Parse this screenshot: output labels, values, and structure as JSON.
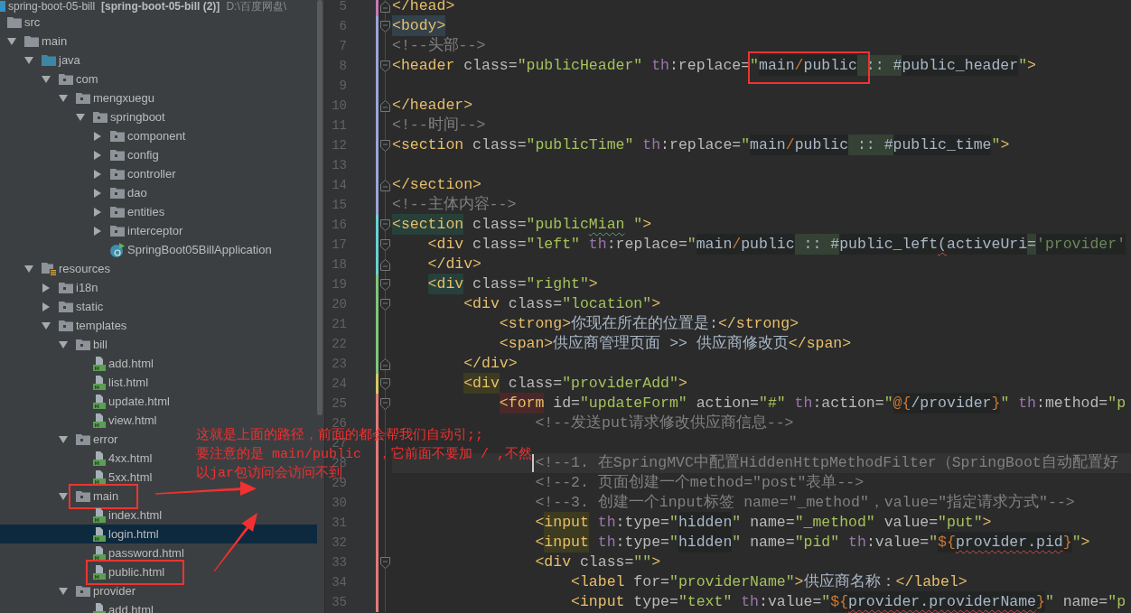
{
  "project_tree": {
    "items": [
      {
        "label": "spring-boot-05-bill",
        "module": "[spring-boot-05-bill (2)]",
        "path": "D:\\百度网盘\\",
        "kind": "module",
        "selected": false,
        "framed": false,
        "children": [
          {
            "label": "src",
            "kind": "folder",
            "selected": false,
            "framed": false,
            "children": [
              {
                "label": "main",
                "kind": "folder",
                "expanded": true,
                "selected": false,
                "framed": false,
                "children": [
                  {
                    "label": "java",
                    "kind": "source-root",
                    "expanded": true,
                    "selected": false,
                    "framed": false,
                    "children": [
                      {
                        "label": "com",
                        "kind": "package",
                        "expanded": true,
                        "selected": false,
                        "framed": false,
                        "children": [
                          {
                            "label": "mengxuegu",
                            "kind": "package",
                            "expanded": true,
                            "selected": false,
                            "framed": false,
                            "children": [
                              {
                                "label": "springboot",
                                "kind": "package",
                                "expanded": true,
                                "selected": false,
                                "framed": false,
                                "children": [
                                  {
                                    "label": "component",
                                    "kind": "package",
                                    "expanded": false,
                                    "selected": false,
                                    "framed": false
                                  },
                                  {
                                    "label": "config",
                                    "kind": "package",
                                    "expanded": false,
                                    "selected": false,
                                    "framed": false
                                  },
                                  {
                                    "label": "controller",
                                    "kind": "package",
                                    "expanded": false,
                                    "selected": false,
                                    "framed": false
                                  },
                                  {
                                    "label": "dao",
                                    "kind": "package",
                                    "expanded": false,
                                    "selected": false,
                                    "framed": false
                                  },
                                  {
                                    "label": "entities",
                                    "kind": "package",
                                    "expanded": false,
                                    "selected": false,
                                    "framed": false
                                  },
                                  {
                                    "label": "interceptor",
                                    "kind": "package",
                                    "expanded": false,
                                    "selected": false,
                                    "framed": false
                                  },
                                  {
                                    "label": "SpringBoot05BillApplication",
                                    "kind": "app-class",
                                    "selected": false,
                                    "framed": false
                                  }
                                ]
                              }
                            ]
                          }
                        ]
                      }
                    ]
                  },
                  {
                    "label": "resources",
                    "kind": "resource-root",
                    "expanded": true,
                    "selected": false,
                    "framed": false,
                    "children": [
                      {
                        "label": "i18n",
                        "kind": "package",
                        "expanded": false,
                        "selected": false,
                        "framed": false
                      },
                      {
                        "label": "static",
                        "kind": "package",
                        "expanded": false,
                        "selected": false,
                        "framed": false
                      },
                      {
                        "label": "templates",
                        "kind": "package",
                        "expanded": true,
                        "selected": false,
                        "framed": false,
                        "children": [
                          {
                            "label": "bill",
                            "kind": "package",
                            "expanded": true,
                            "selected": false,
                            "framed": false,
                            "children": [
                              {
                                "label": "add.html",
                                "kind": "html",
                                "selected": false,
                                "framed": false
                              },
                              {
                                "label": "list.html",
                                "kind": "html",
                                "selected": false,
                                "framed": false
                              },
                              {
                                "label": "update.html",
                                "kind": "html",
                                "selected": false,
                                "framed": false
                              },
                              {
                                "label": "view.html",
                                "kind": "html",
                                "selected": false,
                                "framed": false
                              }
                            ]
                          },
                          {
                            "label": "error",
                            "kind": "package",
                            "expanded": true,
                            "selected": false,
                            "framed": false,
                            "children": [
                              {
                                "label": "4xx.html",
                                "kind": "html",
                                "selected": false,
                                "framed": false
                              },
                              {
                                "label": "5xx.html",
                                "kind": "html",
                                "selected": false,
                                "framed": false
                              }
                            ]
                          },
                          {
                            "label": "main",
                            "kind": "package",
                            "expanded": true,
                            "selected": false,
                            "framed": true,
                            "children": [
                              {
                                "label": "index.html",
                                "kind": "html",
                                "selected": false,
                                "framed": false
                              },
                              {
                                "label": "login.html",
                                "kind": "html",
                                "selected": true,
                                "framed": false
                              },
                              {
                                "label": "password.html",
                                "kind": "html",
                                "selected": false,
                                "framed": false
                              },
                              {
                                "label": "public.html",
                                "kind": "html",
                                "selected": false,
                                "framed": true
                              }
                            ]
                          },
                          {
                            "label": "provider",
                            "kind": "package",
                            "expanded": true,
                            "selected": false,
                            "framed": false,
                            "children": [
                              {
                                "label": "add.html",
                                "kind": "html",
                                "selected": false,
                                "framed": false
                              }
                            ]
                          }
                        ]
                      }
                    ]
                  }
                ]
              }
            ]
          }
        ]
      }
    ]
  },
  "editor": {
    "lines": [
      {
        "number": "5",
        "kind": "close",
        "color": "#c879b6",
        "current": false,
        "tokens": [
          {
            "text": "</head>",
            "kind": "tag"
          }
        ]
      },
      {
        "number": "6",
        "kind": "open",
        "color": "#9aa5dc",
        "current": false,
        "tokens": [
          {
            "text": "<body>",
            "kind": "tagpair"
          }
        ]
      },
      {
        "number": "7",
        "kind": "plain",
        "color": "#9aa5dc",
        "current": false,
        "tokens": [
          {
            "text": "<!--头部-->",
            "kind": "comment"
          }
        ]
      },
      {
        "number": "8",
        "kind": "open",
        "color": "#9aa5dc",
        "current": false,
        "tokens": [
          {
            "text": "<header",
            "kind": "tag"
          },
          {
            "text": " class=",
            "kind": "attr"
          },
          {
            "text": "\"publicHeader\"",
            "kind": "value"
          },
          {
            "text": " th",
            "kind": "ns"
          },
          {
            "text": ":replace=",
            "kind": "attr"
          },
          {
            "text": "\"",
            "kind": "value",
            "framed": true
          },
          {
            "text": "main",
            "kind": "inject",
            "framed": true
          },
          {
            "text": "/",
            "kind": "injectop",
            "framed": true
          },
          {
            "text": "public",
            "kind": "inject",
            "framed": true
          },
          {
            "text": " :: #",
            "kind": "usage"
          },
          {
            "text": "public_header",
            "kind": "inject"
          },
          {
            "text": "\"",
            "kind": "value"
          },
          {
            "text": ">",
            "kind": "tag"
          }
        ]
      },
      {
        "number": "9",
        "kind": "plain",
        "color": "#9aa5dc",
        "current": false
      },
      {
        "number": "10",
        "kind": "close",
        "color": "#9aa5dc",
        "current": false,
        "tokens": [
          {
            "text": "</header>",
            "kind": "tag"
          }
        ]
      },
      {
        "number": "11",
        "kind": "plain",
        "color": "#9aa5dc",
        "current": false,
        "tokens": [
          {
            "text": "<!--时间-->",
            "kind": "comment"
          }
        ]
      },
      {
        "number": "12",
        "kind": "open",
        "color": "#9aa5dc",
        "current": false,
        "tokens": [
          {
            "text": "<section",
            "kind": "tag"
          },
          {
            "text": " class=",
            "kind": "attr"
          },
          {
            "text": "\"publicTime\"",
            "kind": "value"
          },
          {
            "text": " th",
            "kind": "ns"
          },
          {
            "text": ":replace=",
            "kind": "attr"
          },
          {
            "text": "\"",
            "kind": "value"
          },
          {
            "text": "main",
            "kind": "inject"
          },
          {
            "text": "/",
            "kind": "injectop"
          },
          {
            "text": "public",
            "kind": "inject"
          },
          {
            "text": " :: #",
            "kind": "usage"
          },
          {
            "text": "public_time",
            "kind": "inject"
          },
          {
            "text": "\"",
            "kind": "value"
          },
          {
            "text": ">",
            "kind": "tag"
          }
        ]
      },
      {
        "number": "13",
        "kind": "plain",
        "color": "#9aa5dc",
        "current": false
      },
      {
        "number": "14",
        "kind": "close",
        "color": "#9aa5dc",
        "current": false,
        "tokens": [
          {
            "text": "</section>",
            "kind": "tag"
          }
        ]
      },
      {
        "number": "15",
        "kind": "plain",
        "color": "#9aa5dc",
        "current": false,
        "tokens": [
          {
            "text": "<!--主体内容-->",
            "kind": "comment"
          }
        ]
      },
      {
        "number": "16",
        "kind": "open",
        "color": "#6cd0d0",
        "current": false,
        "tokens": [
          {
            "text": "<section",
            "kind": "tagscope"
          },
          {
            "text": " class=",
            "kind": "attr"
          },
          {
            "text": "\"public",
            "kind": "value"
          },
          {
            "text": "Mian",
            "kind": "typo"
          },
          {
            "text": " \"",
            "kind": "value"
          },
          {
            "text": ">",
            "kind": "tag"
          }
        ]
      },
      {
        "number": "17",
        "kind": "open",
        "color": "#6cd0d0",
        "current": false,
        "tokens": [
          {
            "text": "    <div",
            "kind": "tag"
          },
          {
            "text": " class=",
            "kind": "attr"
          },
          {
            "text": "\"left\"",
            "kind": "value"
          },
          {
            "text": " th",
            "kind": "ns"
          },
          {
            "text": ":replace=",
            "kind": "attr"
          },
          {
            "text": "\"",
            "kind": "value"
          },
          {
            "text": "main",
            "kind": "inject"
          },
          {
            "text": "/",
            "kind": "injectop"
          },
          {
            "text": "public",
            "kind": "inject"
          },
          {
            "text": " :: #",
            "kind": "usage"
          },
          {
            "text": "public_left",
            "kind": "inject"
          },
          {
            "text": "(",
            "kind": "unresolved"
          },
          {
            "text": "activeUri",
            "kind": "inject"
          },
          {
            "text": "=",
            "kind": "usage"
          },
          {
            "text": "'provider'",
            "kind": "injectstring"
          }
        ]
      },
      {
        "number": "18",
        "kind": "close",
        "color": "#6cd0d0",
        "current": false,
        "tokens": [
          {
            "text": "    </div>",
            "kind": "tag"
          }
        ]
      },
      {
        "number": "19",
        "kind": "open",
        "color": "#7ec67e",
        "current": false,
        "tokens": [
          {
            "text": "    <div",
            "kind": "tagscope"
          },
          {
            "text": " class=",
            "kind": "attr"
          },
          {
            "text": "\"right\"",
            "kind": "value"
          },
          {
            "text": ">",
            "kind": "tag"
          }
        ]
      },
      {
        "number": "20",
        "kind": "open",
        "color": "#7ec67e",
        "current": false,
        "tokens": [
          {
            "text": "        <div",
            "kind": "tag"
          },
          {
            "text": " class=",
            "kind": "attr"
          },
          {
            "text": "\"location\"",
            "kind": "value"
          },
          {
            "text": ">",
            "kind": "tag"
          }
        ]
      },
      {
        "number": "21",
        "kind": "plain",
        "color": "#7ec67e",
        "current": false,
        "tokens": [
          {
            "text": "            <strong>",
            "kind": "tag"
          },
          {
            "text": "你现在所在的位置是:",
            "kind": "text"
          },
          {
            "text": "</strong>",
            "kind": "tag"
          }
        ]
      },
      {
        "number": "22",
        "kind": "plain",
        "color": "#7ec67e",
        "current": false,
        "tokens": [
          {
            "text": "            <span>",
            "kind": "tag"
          },
          {
            "text": "供应商管理页面 >> 供应商修改页",
            "kind": "text"
          },
          {
            "text": "</span>",
            "kind": "tag"
          }
        ]
      },
      {
        "number": "23",
        "kind": "close",
        "color": "#7ec67e",
        "current": false,
        "tokens": [
          {
            "text": "        </div>",
            "kind": "tag"
          }
        ]
      },
      {
        "number": "24",
        "kind": "open",
        "color": "#d2c76a",
        "current": false,
        "tokens": [
          {
            "text": "        <div",
            "kind": "tagwarn"
          },
          {
            "text": " class=",
            "kind": "attr"
          },
          {
            "text": "\"providerAdd\"",
            "kind": "value"
          },
          {
            "text": ">",
            "kind": "tag"
          }
        ]
      },
      {
        "number": "25",
        "kind": "open",
        "color": "#e07b7b",
        "current": false,
        "tokens": [
          {
            "text": "            <form",
            "kind": "tagerror"
          },
          {
            "text": " id=",
            "kind": "attr"
          },
          {
            "text": "\"updateForm\"",
            "kind": "value"
          },
          {
            "text": " action=",
            "kind": "attr"
          },
          {
            "text": "\"#\"",
            "kind": "value"
          },
          {
            "text": " th",
            "kind": "ns"
          },
          {
            "text": ":action=",
            "kind": "attr"
          },
          {
            "text": "\"",
            "kind": "value"
          },
          {
            "text": "@{",
            "kind": "injectop"
          },
          {
            "text": "/provider",
            "kind": "inject"
          },
          {
            "text": "}",
            "kind": "injectop"
          },
          {
            "text": "\"",
            "kind": "value"
          },
          {
            "text": " th",
            "kind": "ns"
          },
          {
            "text": ":method=",
            "kind": "attr"
          },
          {
            "text": "\"p",
            "kind": "value"
          }
        ]
      },
      {
        "number": "26",
        "kind": "plain",
        "color": "#e07b7b",
        "current": false,
        "tokens": [
          {
            "text": "                <!--发送put请求修改供应商信息-->",
            "kind": "comment"
          }
        ]
      },
      {
        "number": "27",
        "kind": "plain",
        "color": "#e07b7b",
        "current": false
      },
      {
        "number": "28",
        "kind": "plain",
        "color": "#e07b7b",
        "current": true,
        "tokens": [
          {
            "text": "                <!--1. 在SpringMVC中配置HiddenHttpMethodFilter（SpringBoot自动配置好",
            "kind": "comment"
          }
        ]
      },
      {
        "number": "29",
        "kind": "plain",
        "color": "#e07b7b",
        "current": false,
        "tokens": [
          {
            "text": "                <!--2. 页面创建一个method=\"post\"表单-->",
            "kind": "comment"
          }
        ]
      },
      {
        "number": "30",
        "kind": "plain",
        "color": "#e07b7b",
        "current": false,
        "tokens": [
          {
            "text": "                <!--3. 创建一个input标签 name=\"_method\"，value=\"指定请求方式\"-->",
            "kind": "comment"
          }
        ]
      },
      {
        "number": "31",
        "kind": "plain",
        "color": "#e07b7b",
        "current": false,
        "tokens": [
          {
            "text": "                <",
            "kind": "tag"
          },
          {
            "text": "input",
            "kind": "tagwarn"
          },
          {
            "text": " th",
            "kind": "ns"
          },
          {
            "text": ":type=",
            "kind": "attr"
          },
          {
            "text": "\"",
            "kind": "value"
          },
          {
            "text": "hidden",
            "kind": "inject"
          },
          {
            "text": "\"",
            "kind": "value"
          },
          {
            "text": " name=",
            "kind": "attr"
          },
          {
            "text": "\"_method\"",
            "kind": "value"
          },
          {
            "text": " value=",
            "kind": "attr"
          },
          {
            "text": "\"put\"",
            "kind": "value"
          },
          {
            "text": ">",
            "kind": "tag"
          }
        ]
      },
      {
        "number": "32",
        "kind": "plain",
        "color": "#e07b7b",
        "current": false,
        "tokens": [
          {
            "text": "                <",
            "kind": "tag"
          },
          {
            "text": "input",
            "kind": "tagwarn"
          },
          {
            "text": " th",
            "kind": "ns"
          },
          {
            "text": ":type=",
            "kind": "attr"
          },
          {
            "text": "\"",
            "kind": "value"
          },
          {
            "text": "hidden",
            "kind": "inject"
          },
          {
            "text": "\"",
            "kind": "value"
          },
          {
            "text": " name=",
            "kind": "attr"
          },
          {
            "text": "\"pid\"",
            "kind": "value"
          },
          {
            "text": " th",
            "kind": "ns"
          },
          {
            "text": ":value=",
            "kind": "attr"
          },
          {
            "text": "\"",
            "kind": "value"
          },
          {
            "text": "${",
            "kind": "injectop"
          },
          {
            "text": "provider.pid",
            "kind": "unresolved"
          },
          {
            "text": "}",
            "kind": "injectop"
          },
          {
            "text": "\"",
            "kind": "value"
          },
          {
            "text": ">",
            "kind": "tag"
          }
        ]
      },
      {
        "number": "33",
        "kind": "open",
        "color": "#e07b7b",
        "current": false,
        "tokens": [
          {
            "text": "                <div",
            "kind": "tag"
          },
          {
            "text": " class=",
            "kind": "attr"
          },
          {
            "text": "\"\"",
            "kind": "value"
          },
          {
            "text": ">",
            "kind": "tag"
          }
        ]
      },
      {
        "number": "34",
        "kind": "plain",
        "color": "#e07b7b",
        "current": false,
        "tokens": [
          {
            "text": "                    <label",
            "kind": "tag"
          },
          {
            "text": " for=",
            "kind": "attr"
          },
          {
            "text": "\"providerName\"",
            "kind": "value"
          },
          {
            "text": ">",
            "kind": "tag"
          },
          {
            "text": "供应商名称：",
            "kind": "text"
          },
          {
            "text": "</label>",
            "kind": "tag"
          }
        ]
      },
      {
        "number": "35",
        "kind": "plain",
        "color": "#e07b7b",
        "current": false,
        "tokens": [
          {
            "text": "                    <input",
            "kind": "tag"
          },
          {
            "text": " type=",
            "kind": "attr"
          },
          {
            "text": "\"text\"",
            "kind": "value"
          },
          {
            "text": " th",
            "kind": "ns"
          },
          {
            "text": ":value=",
            "kind": "attr"
          },
          {
            "text": "\"",
            "kind": "value"
          },
          {
            "text": "${",
            "kind": "injectop"
          },
          {
            "text": "provider.providerName",
            "kind": "unresolved"
          },
          {
            "text": "}",
            "kind": "injectop"
          },
          {
            "text": "\"",
            "kind": "value"
          },
          {
            "text": " name=",
            "kind": "attr"
          },
          {
            "text": "\"p",
            "kind": "value"
          }
        ]
      }
    ]
  },
  "annotation": {
    "note": [
      "这就是上面的路径，前面的都会帮我们自动引;;",
      "要注意的是 main/public  ，它前面不要加 / ,不然",
      "以jar包访问会访问不到"
    ]
  }
}
